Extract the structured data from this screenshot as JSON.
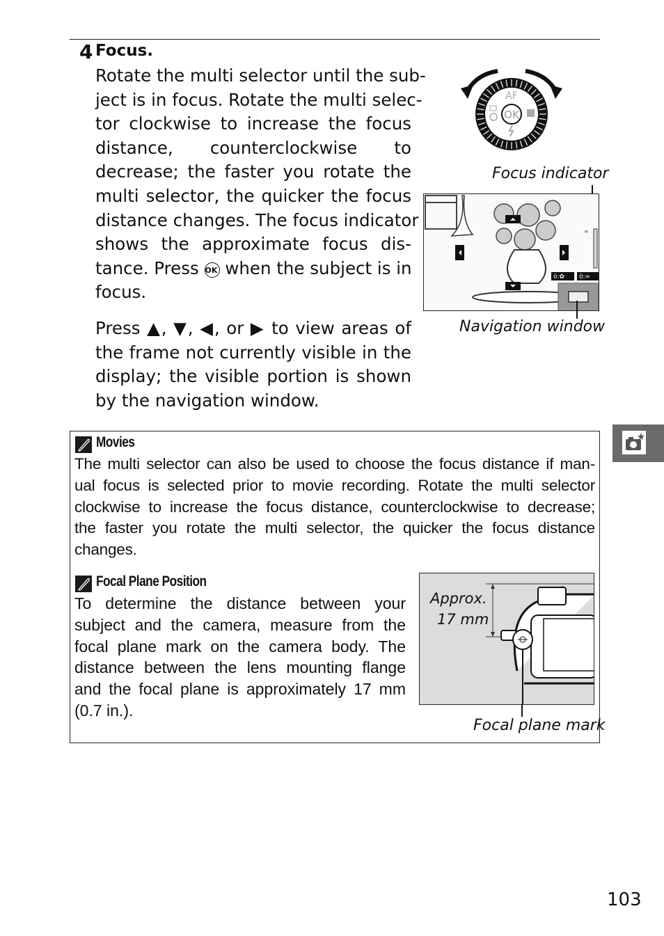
{
  "step": {
    "number": "4",
    "title": "Focus.",
    "paragraph1_lines": [
      "Rotate the multi selector until the sub-",
      "ject is in focus. Rotate the multi selec-",
      "tor clockwise to increase the focus",
      "distance, counterclockwise to",
      "decrease; the faster you rotate the",
      "multi selector, the quicker the focus",
      "distance changes. The focus indicator",
      "shows the approximate focus dis-",
      "tance. Press",
      "when the subject is in",
      "focus."
    ],
    "paragraph2_lines": [
      "Press ▲, ▼, ◀, or ▶ to view areas of",
      "the frame not currently visible in the",
      "display; the visible portion is shown",
      "by the navigation window."
    ],
    "ok_button_glyph": "OK"
  },
  "figures": {
    "dial": {
      "label_top": "AF",
      "label_center": "OK",
      "rotation": "clockwise / counterclockwise arrows"
    },
    "focus_indicator_caption": "Focus indicator",
    "navigation_window_caption": "Navigation window",
    "lcd_badges": [
      "ō:✿",
      "ō:∞"
    ]
  },
  "side_tab": {
    "icon": "camera-star-icon",
    "color": "#6a6a6a"
  },
  "notes": {
    "movies": {
      "title": "Movies",
      "lines": [
        "The multi selector can also be used to choose the focus distance if man-",
        "ual focus is selected prior to movie recording. Rotate the multi selector",
        "clockwise to increase the focus distance, counterclockwise to decrease;",
        "the faster you rotate the multi selector, the quicker the focus distance",
        "changes."
      ]
    },
    "focal_plane": {
      "title": "Focal Plane Position",
      "lines": [
        "To determine the distance between your",
        "subject and the camera, measure from the",
        "focal plane mark on the camera body. The",
        "distance between the lens mounting flange",
        "and the focal plane is approximately 17 mm",
        "(0.7 in.)."
      ],
      "figure_label_1": "Approx.",
      "figure_label_2": "17 mm",
      "figure_caption": "Focal plane mark"
    }
  },
  "page_number": "103"
}
